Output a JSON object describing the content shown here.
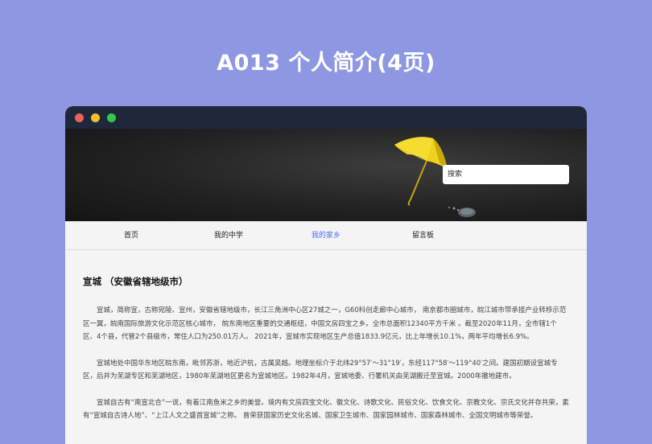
{
  "page": {
    "title": "A013 个人简介(4页)"
  },
  "window": {
    "controls": [
      "close",
      "minimize",
      "maximize"
    ]
  },
  "banner": {
    "search_placeholder": "搜索",
    "image": "yellow-umbrella-icon"
  },
  "nav": {
    "items": [
      {
        "label": "首页",
        "active": false
      },
      {
        "label": "我的中学",
        "active": false
      },
      {
        "label": "我的家乡",
        "active": true
      },
      {
        "label": "留言板",
        "active": false
      }
    ],
    "active_color": "#4a6cf0"
  },
  "article": {
    "title": "宣城 （安徽省辖地级市）",
    "paragraphs": [
      "宣城，简称宣，古称宛陵、宣州，安徽省辖地级市，长江三角洲中心区27城之一，G60科创走廊中心城市， 南京都市圈城市，皖江城市带承接产业转移示范区一翼，皖南国际旅游文化示范区核心城市， 皖东南地区重要的交通枢纽，中国文房四宝之乡。全市总面积12340平方千米 。截至2020年11月，全市辖1个区、4个县，代管2个县级市，常住人口为250.01万人。 2021年，宣城市实现地区生产总值1833.9亿元，比上年增长10.1%，两年平均增长6.9%。",
      "宣城地处中国华东地区皖东南，毗邻苏浙，地近沪杭，古属吴越。地理坐标介于北纬29°57′～31°19′，东经117°58′～119°40′之间。建国初期设宣城专区，后并为芜湖专区和芜湖地区，1980年芜湖地区更名为宣城地区。1982年4月，宣城地委、行署机关由芜湖搬迁至宣城。2000年撤地建市。",
      "宣城自古有“南宣北合”一说，有着江南鱼米之乡的美誉。境内有文房四宝文化、徽文化、诗歌文化、民俗文化、饮食文化、宗教文化、宗氏文化并存共荣，素有“宣城自古诗人地”、“上江人文之盛首宣城”之称。 曾荣获国家历史文化名城、国家卫生城市、国家园林城市、国家森林城市、全国文明城市等荣誉。"
    ]
  },
  "colors": {
    "background": "#8e97e2",
    "titlebar": "#1f283a",
    "close": "#ed6158",
    "minimize": "#f4bf2d",
    "maximize": "#34c749"
  }
}
